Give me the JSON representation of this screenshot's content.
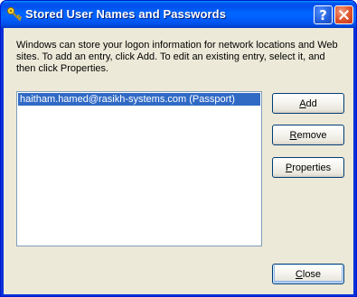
{
  "window": {
    "title": "Stored User Names and Passwords",
    "title_icon": "keys-icon",
    "help_button": "?",
    "close_button": "×"
  },
  "description": "Windows can store your logon information for network locations and Web sites. To add an entry, click Add. To edit an existing entry, select it, and then click Properties.",
  "credentials_list": {
    "items": [
      {
        "label": "haitham.hamed@rasikh-systems.com (Passport)",
        "selected": true
      }
    ]
  },
  "buttons": {
    "add": "Add",
    "remove": "Remove",
    "properties": "Properties",
    "close": "Close"
  },
  "colors": {
    "title_bar": "#0058ee",
    "dialog_background": "#ece9d8",
    "selection": "#316ac5",
    "close_button": "#e0572f"
  }
}
